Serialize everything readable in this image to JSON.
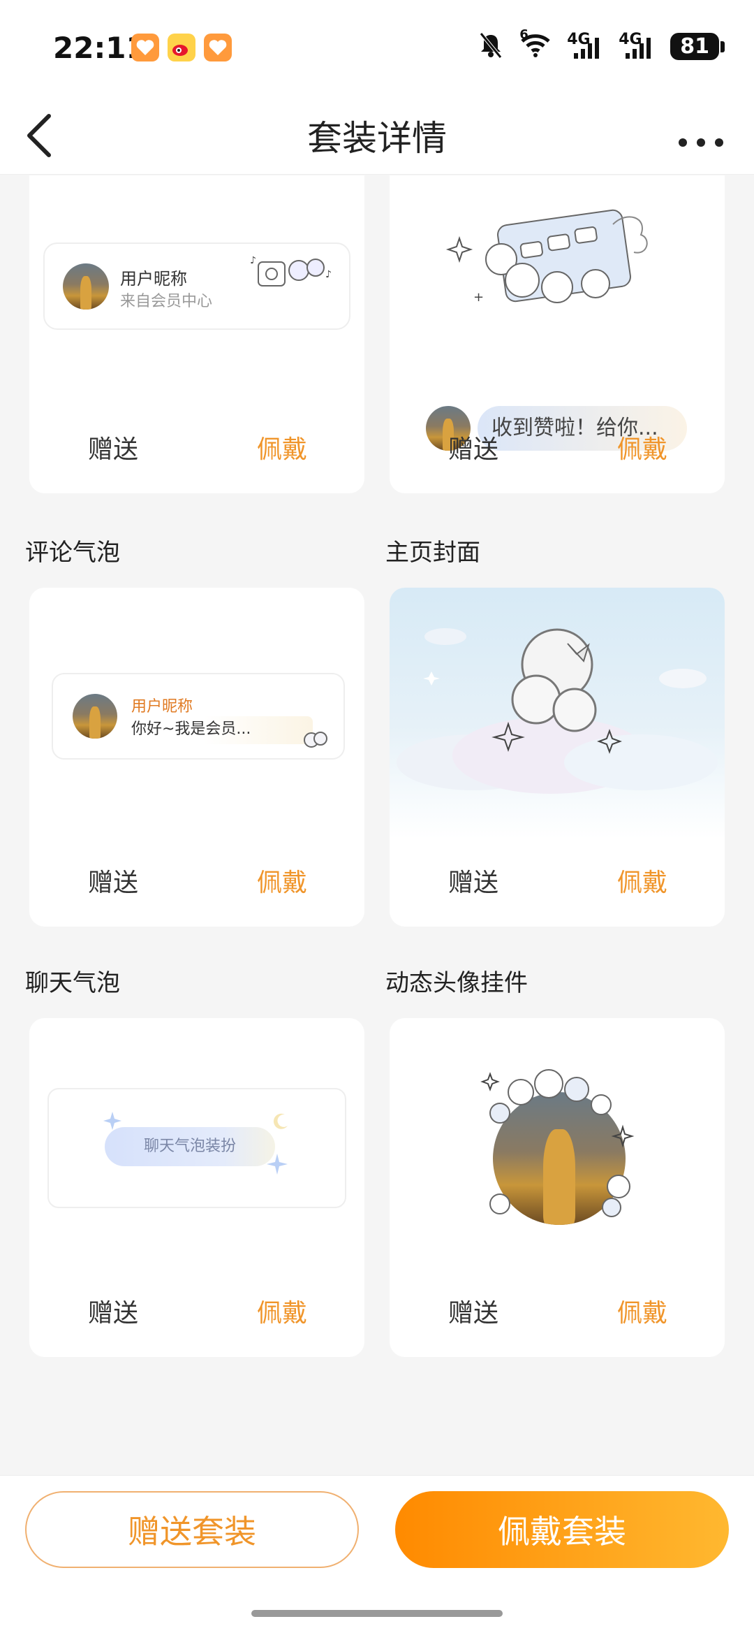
{
  "status_bar": {
    "time": "22:11",
    "network_labels": [
      "6",
      "4G",
      "4G"
    ],
    "battery": "81",
    "icons": [
      "heart-app-icon",
      "weibo-icon",
      "heart-app-icon",
      "mute-bell-icon",
      "wifi-icon",
      "signal-icon",
      "signal-icon",
      "battery-icon"
    ]
  },
  "nav": {
    "title": "套装详情",
    "back_icon": "chevron-left-icon",
    "more_icon": "more-dots-icon"
  },
  "cards": {
    "card1": {
      "preview": {
        "nickname": "用户昵称",
        "subtitle": "来自会员中心"
      },
      "gift_label": "赠送",
      "wear_label": "佩戴"
    },
    "card2": {
      "preview": {
        "bubble_text": "收到赞啦！给你..."
      },
      "gift_label": "赠送",
      "wear_label": "佩戴"
    },
    "comment_bubble": {
      "title": "评论气泡",
      "preview": {
        "nickname": "用户昵称",
        "text": "你好~我是会员..."
      },
      "gift_label": "赠送",
      "wear_label": "佩戴"
    },
    "home_cover": {
      "title": "主页封面",
      "gift_label": "赠送",
      "wear_label": "佩戴"
    },
    "chat_bubble": {
      "title": "聊天气泡",
      "preview": {
        "text": "聊天气泡装扮"
      },
      "gift_label": "赠送",
      "wear_label": "佩戴"
    },
    "avatar_pendant": {
      "title": "动态头像挂件",
      "gift_label": "赠送",
      "wear_label": "佩戴"
    }
  },
  "bottom_bar": {
    "gift_suite_label": "赠送套装",
    "wear_suite_label": "佩戴套装"
  },
  "colors": {
    "accent": "#f0952a",
    "primary_gradient_start": "#ff8a00",
    "primary_gradient_end": "#ffb830",
    "nickname_orange": "#e07a22"
  }
}
